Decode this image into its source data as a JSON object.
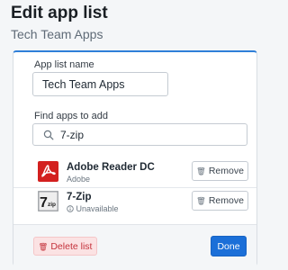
{
  "header": {
    "title": "Edit app list",
    "subtitle": "Tech Team Apps"
  },
  "form": {
    "name_label": "App list name",
    "name_value": "Tech Team Apps",
    "search_label": "Find apps to add",
    "search_value": "7-zip"
  },
  "apps": [
    {
      "name": "Adobe Reader DC",
      "subtitle": "Adobe",
      "icon": "adobe-reader-icon",
      "remove_label": "Remove"
    },
    {
      "name": "7-Zip",
      "subtitle": "Unavailable",
      "icon": "7zip-icon",
      "status_icon": "info-icon",
      "remove_label": "Remove"
    }
  ],
  "footer": {
    "delete_label": "Delete list",
    "done_label": "Done"
  },
  "colors": {
    "accent": "#1b6fd8",
    "danger": "#c4323b",
    "danger_bg": "#fbe2e3"
  }
}
